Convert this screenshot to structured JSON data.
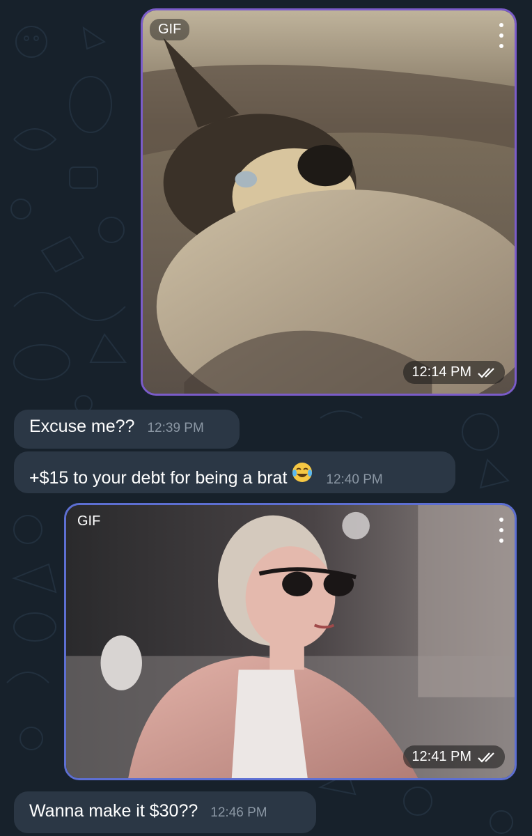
{
  "messages": [
    {
      "type": "gif",
      "direction": "outgoing",
      "badge": "GIF",
      "depicts": "husky dog lying on couch",
      "time": "12:14 PM",
      "status": "read-double-check"
    },
    {
      "type": "text",
      "direction": "incoming",
      "text": "Excuse me??",
      "time": "12:39 PM"
    },
    {
      "type": "text",
      "direction": "incoming",
      "text": "+$15 to your debt for being a brat",
      "emoji": "face-with-tears-of-joy",
      "time": "12:40 PM"
    },
    {
      "type": "gif",
      "direction": "outgoing",
      "badge": "GIF",
      "depicts": "woman in sunglasses and pink fur coat",
      "time": "12:41 PM",
      "status": "read-double-check"
    },
    {
      "type": "text",
      "direction": "incoming",
      "text": "Wanna make it $30??",
      "time": "12:46 PM"
    }
  ],
  "colors": {
    "background": "#17212b",
    "incoming_bubble": "#2b3745",
    "outgoing_gif_border": "#7b5cc9",
    "time_text": "#8b97a4"
  }
}
